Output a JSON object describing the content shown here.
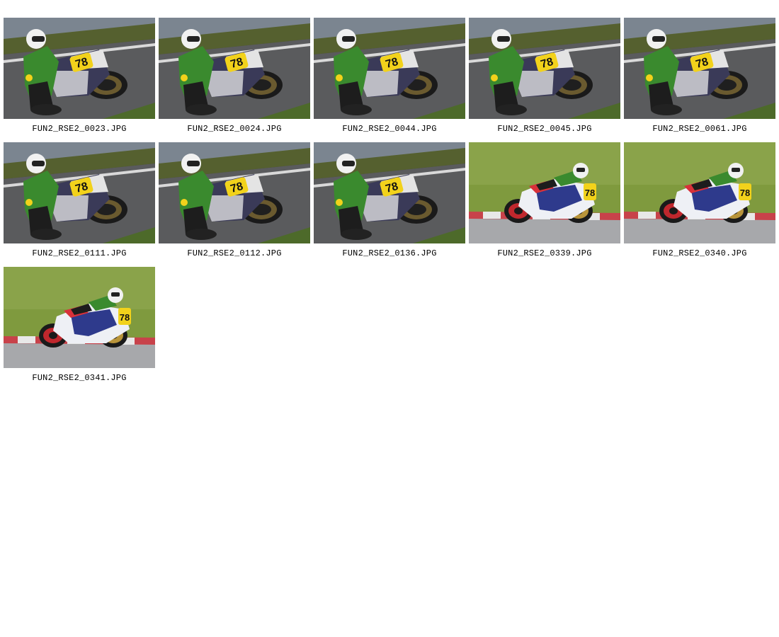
{
  "gallery": {
    "thumbnails": [
      {
        "filename": "FUN2_RSE2_0023.JPG",
        "scene": "dark-corner",
        "number": "78"
      },
      {
        "filename": "FUN2_RSE2_0024.JPG",
        "scene": "dark-corner",
        "number": "78"
      },
      {
        "filename": "FUN2_RSE2_0044.JPG",
        "scene": "dark-corner",
        "number": "78"
      },
      {
        "filename": "FUN2_RSE2_0045.JPG",
        "scene": "dark-corner",
        "number": "78"
      },
      {
        "filename": "FUN2_RSE2_0061.JPG",
        "scene": "dark-corner",
        "number": "78"
      },
      {
        "filename": "FUN2_RSE2_0111.JPG",
        "scene": "dark-corner",
        "number": "78"
      },
      {
        "filename": "FUN2_RSE2_0112.JPG",
        "scene": "dark-corner",
        "number": "78"
      },
      {
        "filename": "FUN2_RSE2_0136.JPG",
        "scene": "dark-corner",
        "number": "78"
      },
      {
        "filename": "FUN2_RSE2_0339.JPG",
        "scene": "grass-side",
        "number": "78"
      },
      {
        "filename": "FUN2_RSE2_0340.JPG",
        "scene": "grass-side",
        "number": "78"
      },
      {
        "filename": "FUN2_RSE2_0341.JPG",
        "scene": "grass-side",
        "number": "78"
      }
    ]
  },
  "colors": {
    "page_background": "#ffffff",
    "caption_text": "#000000",
    "rider_suit": "#3a8a2e",
    "number_plate": "#f2d21b",
    "track_asphalt": "#6f6f72",
    "grass": "#7f9a3e",
    "curb_red": "#c8424a"
  }
}
